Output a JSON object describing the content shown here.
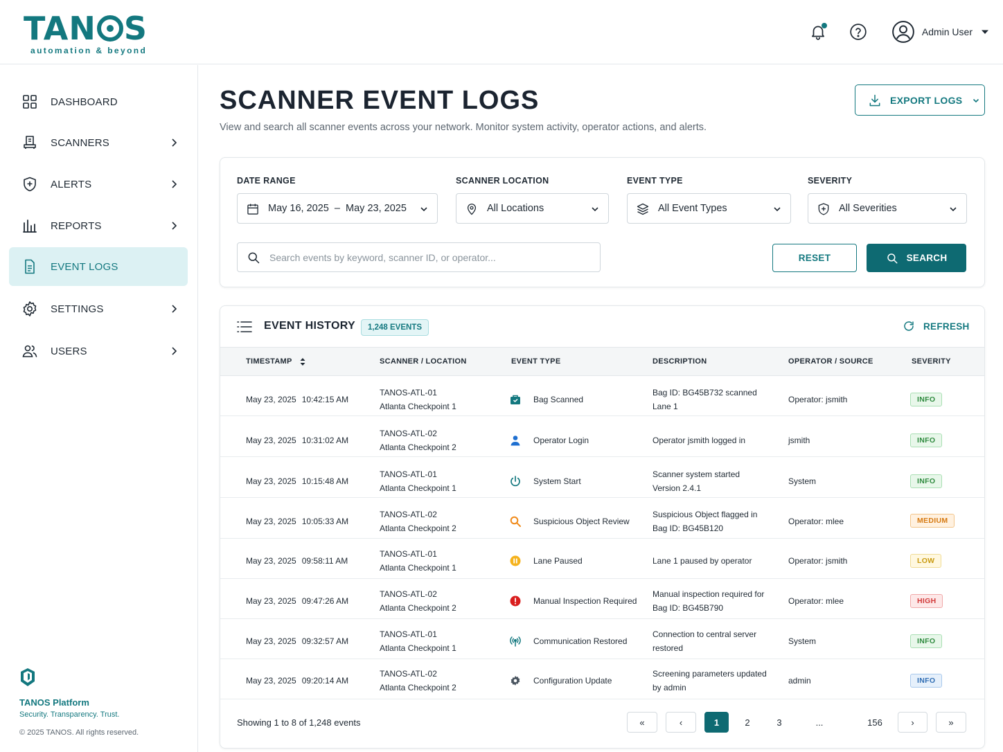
{
  "brand": {
    "name_a": "TAN",
    "name_b": "S",
    "tagline": "automation & beyond"
  },
  "header": {
    "user_name": "Admin User"
  },
  "sidebar": {
    "items": [
      {
        "label": "DASHBOARD"
      },
      {
        "label": "SCANNERS"
      },
      {
        "label": "ALERTS"
      },
      {
        "label": "REPORTS"
      },
      {
        "label": "EVENT LOGS"
      },
      {
        "label": "SETTINGS"
      },
      {
        "label": "USERS"
      }
    ],
    "footer": {
      "platform": "TANOS Platform",
      "tagline": "Security. Transparency. Trust.",
      "copyright": "© 2025 TANOS. All rights reserved."
    }
  },
  "page": {
    "title": "SCANNER EVENT LOGS",
    "subtitle": "View and search all scanner events across your network. Monitor system activity, operator actions, and alerts.",
    "export_label": "EXPORT LOGS"
  },
  "filters": {
    "date_label": "DATE RANGE",
    "date_value": "May 16, 2025  –  May 23, 2025",
    "location_label": "SCANNER LOCATION",
    "location_value": "All Locations",
    "type_label": "EVENT TYPE",
    "type_value": "All Event Types",
    "severity_label": "SEVERITY",
    "severity_value": "All Severities",
    "search_placeholder": "Search events by keyword, scanner ID, or operator...",
    "reset_label": "RESET",
    "search_label": "SEARCH"
  },
  "history": {
    "title": "EVENT HISTORY",
    "badge": "1,248 EVENTS",
    "refresh_label": "REFRESH",
    "columns": [
      "TIMESTAMP",
      "SCANNER / LOCATION",
      "EVENT TYPE",
      "DESCRIPTION",
      "OPERATOR / SOURCE",
      "SEVERITY"
    ],
    "rows": [
      {
        "date": "May 23, 2025",
        "time": "10:42:15 AM",
        "scanner": "TANOS-ATL-01",
        "location": "Atlanta Checkpoint 1",
        "event": "Bag Scanned",
        "icon": "bag-icon",
        "desc1": "Bag ID: BG45B732 scanned",
        "desc2": "Lane 1",
        "operator": "Operator: jsmith",
        "severity": "INFO"
      },
      {
        "date": "May 23, 2025",
        "time": "10:31:02 AM",
        "scanner": "TANOS-ATL-02",
        "location": "Atlanta Checkpoint 2",
        "event": "Operator Login",
        "icon": "user-icon",
        "desc1": "Operator jsmith logged in",
        "desc2": "",
        "operator": "jsmith",
        "severity": "INFO"
      },
      {
        "date": "May 23, 2025",
        "time": "10:15:48 AM",
        "scanner": "TANOS-ATL-01",
        "location": "Atlanta Checkpoint 1",
        "event": "System Start",
        "icon": "power-icon",
        "desc1": "Scanner system started",
        "desc2": "Version 2.4.1",
        "operator": "System",
        "severity": "INFO"
      },
      {
        "date": "May 23, 2025",
        "time": "10:05:33 AM",
        "scanner": "TANOS-ATL-02",
        "location": "Atlanta Checkpoint 2",
        "event": "Suspicious Object Review",
        "icon": "magnifier-icon",
        "desc1": "Suspicious Object flagged in",
        "desc2": "Bag ID: BG45B120",
        "operator": "Operator: mlee",
        "severity": "MEDIUM"
      },
      {
        "date": "May 23, 2025",
        "time": "09:58:11 AM",
        "scanner": "TANOS-ATL-01",
        "location": "Atlanta Checkpoint 1",
        "event": "Lane Paused",
        "icon": "pause-icon",
        "desc1": "Lane 1 paused by operator",
        "desc2": "",
        "operator": "Operator: jsmith",
        "severity": "LOW"
      },
      {
        "date": "May 23, 2025",
        "time": "09:47:26 AM",
        "scanner": "TANOS-ATL-02",
        "location": "Atlanta Checkpoint 2",
        "event": "Manual Inspection Required",
        "icon": "alert-icon",
        "desc1": "Manual inspection required for",
        "desc2": "Bag ID: BG45B790",
        "operator": "Operator: mlee",
        "severity": "HIGH"
      },
      {
        "date": "May 23, 2025",
        "time": "09:32:57 AM",
        "scanner": "TANOS-ATL-01",
        "location": "Atlanta Checkpoint 1",
        "event": "Communication Restored",
        "icon": "signal-icon",
        "desc1": "Connection to central server",
        "desc2": "restored",
        "operator": "System",
        "severity": "INFO"
      },
      {
        "date": "May 23, 2025",
        "time": "09:20:14 AM",
        "scanner": "TANOS-ATL-02",
        "location": "Atlanta Checkpoint 2",
        "event": "Configuration Update",
        "icon": "gear-icon",
        "desc1": "Screening parameters updated",
        "desc2": "by admin",
        "operator": "admin",
        "severity": "INFO"
      }
    ],
    "showing": "Showing 1 to 8 of 1,248 events",
    "pages": {
      "first": "«",
      "prev": "‹",
      "p1": "1",
      "p2": "2",
      "p3": "3",
      "ellipsis": "...",
      "last_page": "156",
      "next": "›",
      "last": "»"
    }
  },
  "colors": {
    "brand": "#13787f",
    "primary_button": "#0e6a72",
    "active_nav": "#dcf1f3"
  }
}
